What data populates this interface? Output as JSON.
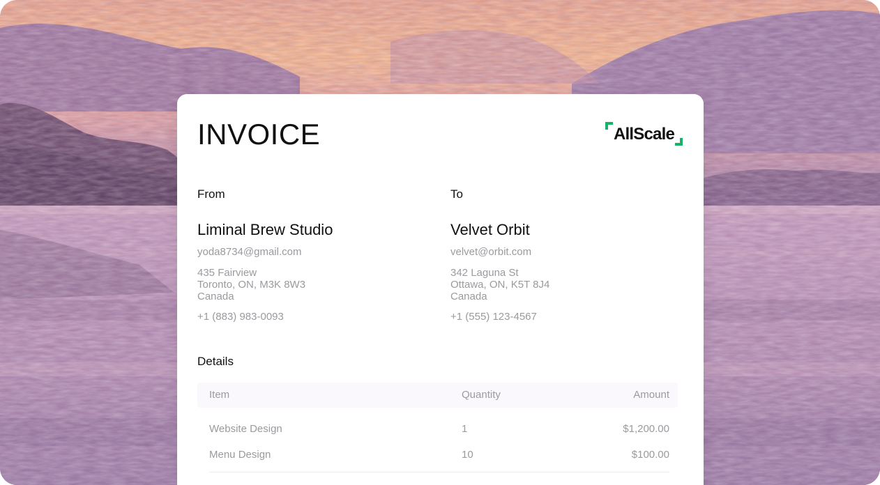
{
  "invoice": {
    "title": "INVOICE",
    "brand": {
      "name": "AllScale",
      "accent_color": "#18b26b"
    },
    "from": {
      "section_label": "From",
      "name": "Liminal Brew Studio",
      "email": "yoda8734@gmail.com",
      "address": [
        "435 Fairview",
        "Toronto, ON, M3K 8W3",
        "Canada"
      ],
      "phone": "+1 (883) 983-0093"
    },
    "to": {
      "section_label": "To",
      "name": "Velvet Orbit",
      "email": "velvet@orbit.com",
      "address": [
        "342 Laguna St",
        "Ottawa, ON, K5T 8J4",
        "Canada"
      ],
      "phone": "+1 (555) 123-4567"
    },
    "details": {
      "section_label": "Details",
      "columns": [
        "Item",
        "Quantity",
        "Amount"
      ],
      "rows": [
        [
          "Website Design",
          "1",
          "$1,200.00"
        ],
        [
          "Menu Design",
          "10",
          "$100.00"
        ]
      ]
    }
  },
  "background": {
    "description_color_top": "#f0a98c",
    "description_color_mid": "#9c7aa2",
    "description_color_bottom": "#8a6a92"
  }
}
